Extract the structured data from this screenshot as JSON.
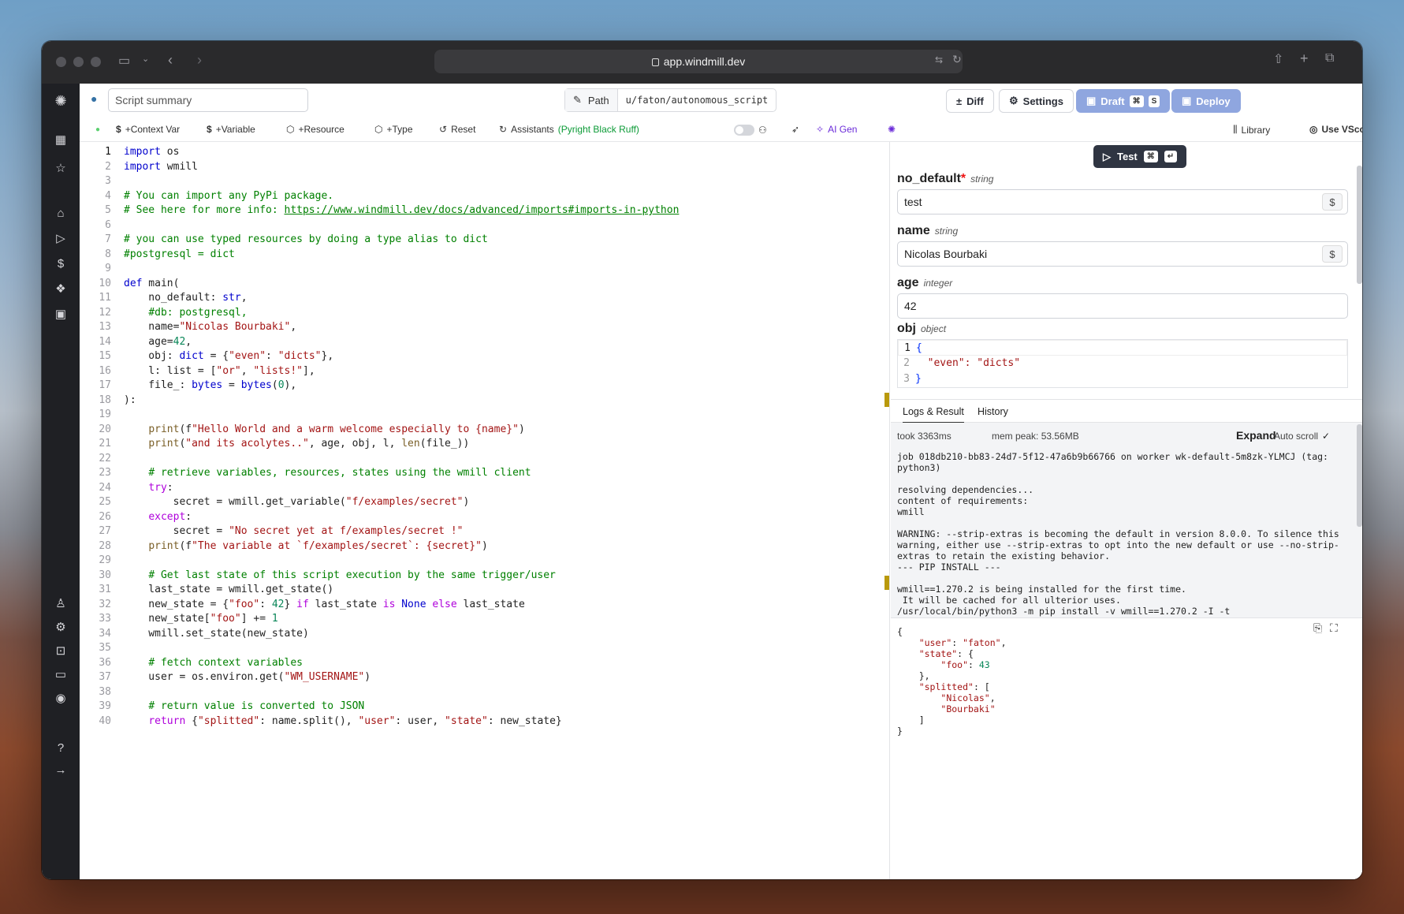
{
  "browser": {
    "url": "app.windmill.dev"
  },
  "header": {
    "summary_placeholder": "Script summary",
    "path_label": "Path",
    "path_value": "u/faton/autonomous_script",
    "diff": "Diff",
    "settings": "Settings",
    "draft": "Draft",
    "draft_kbd1": "⌘",
    "draft_kbd2": "S",
    "deploy": "Deploy"
  },
  "toolbar": {
    "context_var": "+Context Var",
    "variable": "+Variable",
    "resource": "+Resource",
    "type": "+Type",
    "reset": "Reset",
    "assistants": "Assistants",
    "assistants_detail": "(Pyright Black Ruff)",
    "ai_gen": "AI Gen",
    "library": "Library",
    "vscode": "Use VScode"
  },
  "code_lines": [
    "import os",
    "import wmill",
    "",
    "# You can import any PyPi package.",
    "# See here for more info: https://www.windmill.dev/docs/advanced/imports#imports-in-python",
    "",
    "# you can use typed resources by doing a type alias to dict",
    "#postgresql = dict",
    "",
    "def main(",
    "    no_default: str,",
    "    #db: postgresql,",
    "    name=\"Nicolas Bourbaki\",",
    "    age=42,",
    "    obj: dict = {\"even\": \"dicts\"},",
    "    l: list = [\"or\", \"lists!\"],",
    "    file_: bytes = bytes(0),",
    "):",
    "",
    "    print(f\"Hello World and a warm welcome especially to {name}\")",
    "    print(\"and its acolytes..\", age, obj, l, len(file_))",
    "",
    "    # retrieve variables, resources, states using the wmill client",
    "    try:",
    "        secret = wmill.get_variable(\"f/examples/secret\")",
    "    except:",
    "        secret = \"No secret yet at f/examples/secret !\"",
    "    print(f\"The variable at `f/examples/secret`: {secret}\")",
    "",
    "    # Get last state of this script execution by the same trigger/user",
    "    last_state = wmill.get_state()",
    "    new_state = {\"foo\": 42} if last_state is None else last_state",
    "    new_state[\"foo\"] += 1",
    "    wmill.set_state(new_state)",
    "",
    "    # fetch context variables",
    "    user = os.environ.get(\"WM_USERNAME\")",
    "",
    "    # return value is converted to JSON",
    "    return {\"splitted\": name.split(), \"user\": user, \"state\": new_state}"
  ],
  "test_panel": {
    "test": "Test",
    "kbd1": "⌘",
    "kbd2": "↵",
    "args": [
      {
        "name": "no_default",
        "type": "string",
        "value": "test",
        "required": true
      },
      {
        "name": "name",
        "type": "string",
        "value": "Nicolas Bourbaki",
        "required": false
      },
      {
        "name": "age",
        "type": "integer",
        "value": "42",
        "required": false
      },
      {
        "name": "obj",
        "type": "object",
        "required": false
      }
    ],
    "obj_lines": [
      "{",
      "  \"even\": \"dicts\"",
      "}"
    ]
  },
  "results": {
    "tab_logs": "Logs & Result",
    "tab_history": "History",
    "took": "took 3363ms",
    "mem": "mem peak: 53.56MB",
    "expand": "Expand",
    "autoscroll": "Auto scroll",
    "log": "job 018db210-bb83-24d7-5f12-47a6b9b66766 on worker wk-default-5m8zk-YLMCJ (tag:\npython3)\n\nresolving dependencies...\ncontent of requirements:\nwmill\n\nWARNING: --strip-extras is becoming the default in version 8.0.0. To silence this\nwarning, either use --strip-extras to opt into the new default or use --no-strip-\nextras to retain the existing behavior.\n--- PIP INSTALL ---\n\nwmill==1.270.2 is being installed for the first time.\n It will be cached for all ulterior uses.\n/usr/local/bin/python3 -m pip install -v wmill==1.270.2 -I -t",
    "result": "{\n    \"user\": \"faton\",\n    \"state\": {\n        \"foo\": 43\n    },\n    \"splitted\": [\n        \"Nicolas\",\n        \"Bourbaki\"\n    ]\n}"
  }
}
